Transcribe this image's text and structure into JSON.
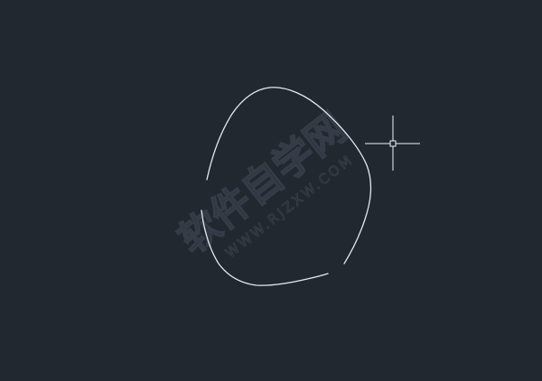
{
  "canvas": {
    "background_color": "#212830",
    "stroke_color": "#e6e9ee",
    "cursor_color": "#f2f4f7"
  },
  "drawing": {
    "shape": "freehand-closed-spline-with-gaps"
  },
  "cursor": {
    "type": "crosshair-with-pickbox",
    "icon": "crosshair-cursor-icon"
  },
  "watermark": {
    "text_cn": "软件自学网",
    "text_url": "WWW.RJZXW.COM",
    "color": "#2e3540"
  }
}
